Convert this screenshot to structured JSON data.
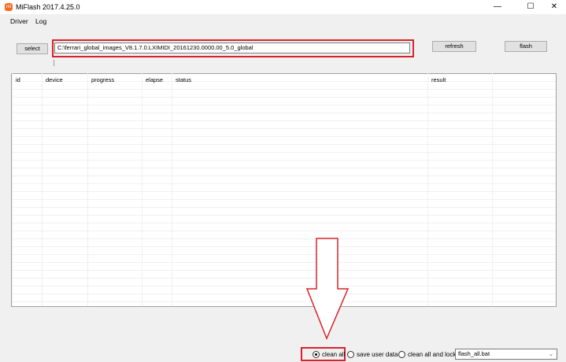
{
  "window": {
    "title": "MiFlash 2017.4.25.0",
    "icon": "mi-logo",
    "minimize": "—",
    "maximize": "☐",
    "close": "✕"
  },
  "menu": [
    {
      "label": "Driver"
    },
    {
      "label": "Log"
    }
  ],
  "toolbar": {
    "select_label": "select",
    "path_value": "C:\\ferrari_global_images_V8.1.7.0.LXIMIDI_20161230.0000.00_5.0_global",
    "refresh_label": "refresh",
    "flash_label": "flash"
  },
  "table": {
    "columns": [
      "id",
      "device",
      "progress",
      "elapse",
      "status",
      "result",
      ""
    ],
    "rows": []
  },
  "options": {
    "clean_all": "clean all",
    "save_user_data": "save user data",
    "clean_all_and_lock": "clean all and lock",
    "selected": "clean all",
    "script_value": "flash_all.bat"
  },
  "annotation": {
    "color": "#d9232c",
    "icon": "arrow-down-outline"
  }
}
